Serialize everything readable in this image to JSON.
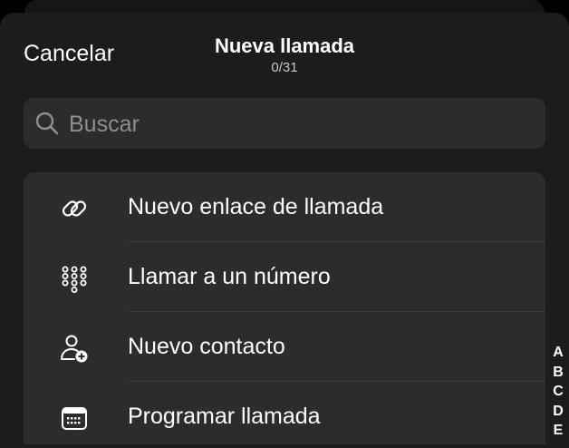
{
  "header": {
    "cancel_label": "Cancelar",
    "title": "Nueva llamada",
    "subtitle": "0/31"
  },
  "search": {
    "placeholder": "Buscar",
    "value": ""
  },
  "menu": {
    "items": [
      {
        "label": "Nuevo enlace de llamada",
        "icon": "link-icon"
      },
      {
        "label": "Llamar a un número",
        "icon": "dialpad-icon"
      },
      {
        "label": "Nuevo contacto",
        "icon": "add-contact-icon"
      },
      {
        "label": "Programar llamada",
        "icon": "calendar-icon"
      }
    ]
  },
  "index": {
    "letters": [
      "A",
      "B",
      "C",
      "D",
      "E"
    ]
  },
  "colors": {
    "background": "#000000",
    "sheet": "#1c1c1e",
    "panel": "#2c2c2e",
    "separator": "#3a3a3c",
    "placeholder": "#8e8e93"
  }
}
